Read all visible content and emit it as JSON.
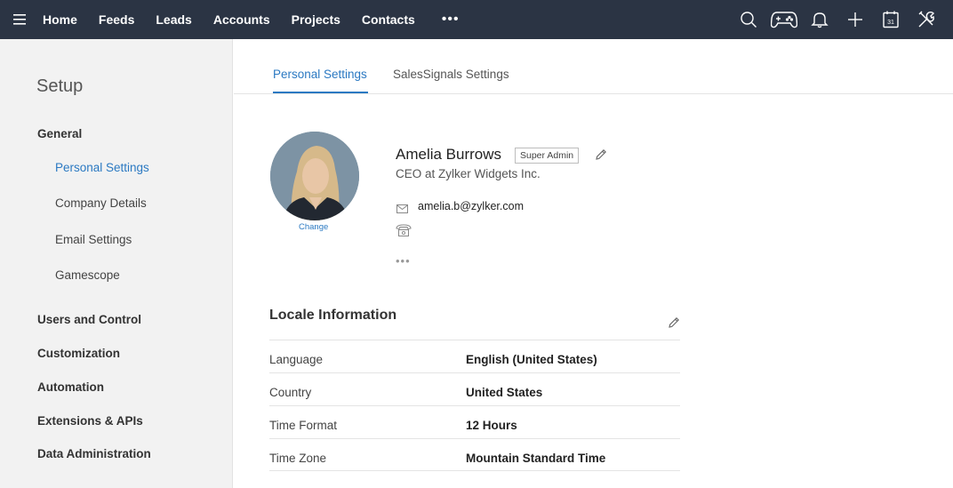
{
  "nav": {
    "items": [
      "Home",
      "Feeds",
      "Leads",
      "Accounts",
      "Projects",
      "Contacts"
    ],
    "more": "•••"
  },
  "top_icons": [
    "search-icon",
    "gamepad-icon",
    "bell-icon",
    "plus-icon",
    "calendar-icon",
    "tools-icon"
  ],
  "calendar_day": "31",
  "sidebar": {
    "title": "Setup",
    "general": "General",
    "general_items": [
      "Personal Settings",
      "Company Details",
      "Email Settings",
      "Gamescope"
    ],
    "sections": [
      "Users and Control",
      "Customization",
      "Automation",
      "Extensions & APIs",
      "Data Administration"
    ]
  },
  "tabs": [
    "Personal Settings",
    "SalesSignals Settings"
  ],
  "profile": {
    "name": "Amelia Burrows",
    "role": "Super Admin",
    "title": "CEO at Zylker Widgets Inc.",
    "email": "amelia.b@zylker.com",
    "change_label": "Change",
    "more": "•••"
  },
  "locale": {
    "title": "Locale Information",
    "rows": [
      {
        "label": "Language",
        "value": "English (United States)"
      },
      {
        "label": "Country",
        "value": "United States"
      },
      {
        "label": "Time Format",
        "value": "12 Hours"
      },
      {
        "label": "Time Zone",
        "value": "Mountain Standard Time"
      }
    ]
  },
  "colors": {
    "topbar": "#2b3444",
    "accent": "#2b79c2",
    "sidebar_bg": "#f2f2f2"
  }
}
